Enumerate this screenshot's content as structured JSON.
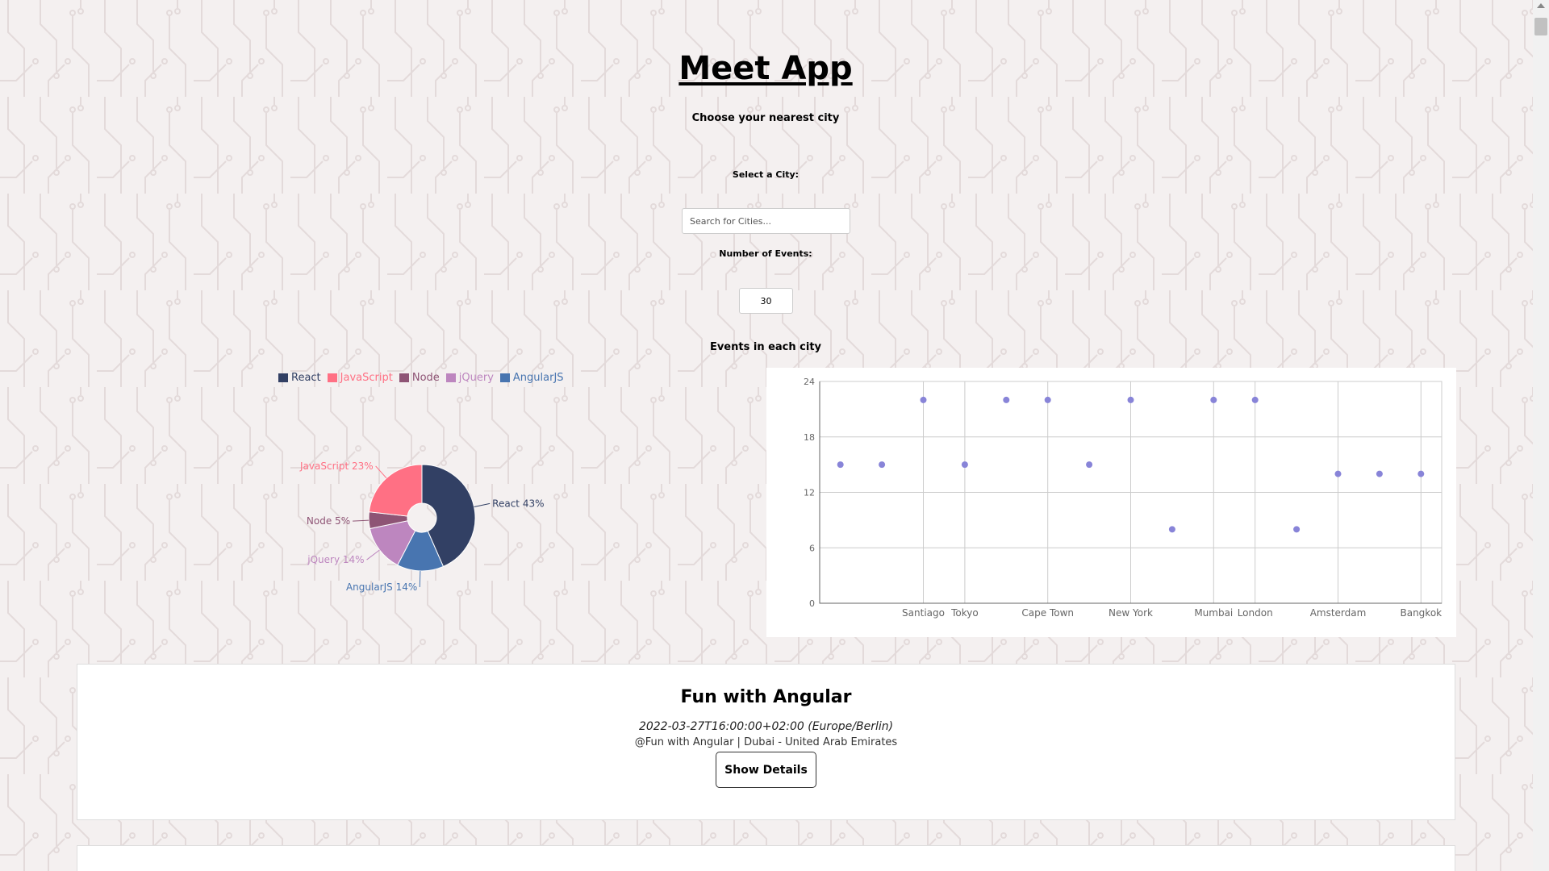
{
  "app": {
    "title": "Meet App",
    "subtitle": "Choose your nearest city"
  },
  "city_search": {
    "label": "Select a City:",
    "placeholder": "Search for Cities...",
    "value": ""
  },
  "number_of_events": {
    "label": "Number of Events:",
    "value": "30"
  },
  "charts_heading": "Events in each city",
  "colors": {
    "background": "#f4f0f0",
    "pattern": "#e2dada",
    "react": "#324064",
    "javascript": "#ff7084",
    "node": "#8e5475",
    "jquery": "#bd86bf",
    "angularjs": "#4875b0",
    "scatter_point": "#8884d8",
    "grid": "#cccccc"
  },
  "chart_data": [
    {
      "type": "pie",
      "title": "",
      "legend_position": "top",
      "slices": [
        {
          "name": "React",
          "value": 43,
          "label": "React 43%",
          "color": "#324064"
        },
        {
          "name": "AngularJS",
          "value": 14,
          "label": "AngularJS 14%",
          "color": "#4875b0"
        },
        {
          "name": "jQuery",
          "value": 14,
          "label": "jQuery 14%",
          "color": "#bd86bf"
        },
        {
          "name": "Node",
          "value": 5,
          "label": "Node 5%",
          "color": "#8e5475"
        },
        {
          "name": "JavaScript",
          "value": 23,
          "label": "JavaScript 23%",
          "color": "#ff7084"
        }
      ],
      "legend": [
        {
          "name": "React",
          "color": "#324064"
        },
        {
          "name": "JavaScript",
          "color": "#ff7084"
        },
        {
          "name": "Node",
          "color": "#8e5475"
        },
        {
          "name": "jQuery",
          "color": "#bd86bf"
        },
        {
          "name": "AngularJS",
          "color": "#4875b0"
        }
      ]
    },
    {
      "type": "scatter",
      "title": "",
      "xlabel": "",
      "ylabel": "",
      "ylim": [
        0,
        24
      ],
      "yticks": [
        0,
        6,
        12,
        18,
        24
      ],
      "grid": true,
      "x": [
        "",
        "",
        "Santiago",
        "Tokyo",
        "",
        "Cape Town",
        "",
        "New York",
        "",
        "Mumbai",
        "London",
        "",
        "Amsterdam",
        "",
        "Bangkok"
      ],
      "y": [
        15,
        15,
        22,
        15,
        22,
        22,
        15,
        22,
        8,
        22,
        22,
        8,
        14,
        14,
        14
      ],
      "color": "#8884d8"
    }
  ],
  "events": [
    {
      "title": "Fun with Angular",
      "date": "2022-03-27T16:00:00+02:00 (Europe/Berlin)",
      "location": "@Fun with Angular | Dubai - United Arab Emirates",
      "button": "Show Details"
    }
  ]
}
